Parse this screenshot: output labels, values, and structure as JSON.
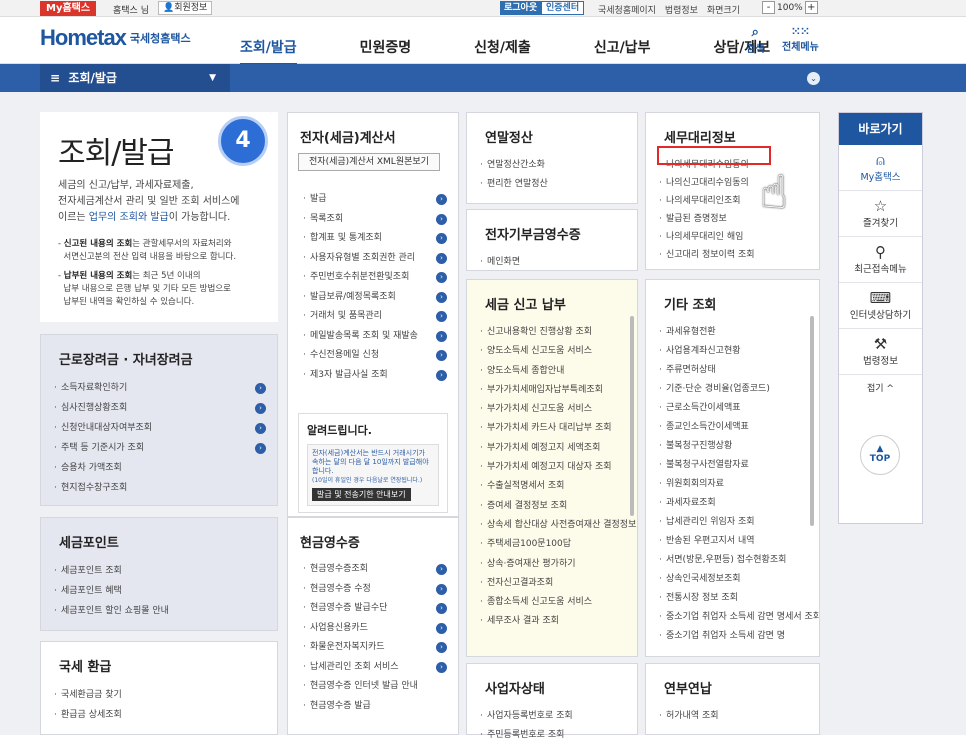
{
  "topbar": {
    "mytax": "My홈택스",
    "user": "홈택스 님",
    "member_info": "회원정보",
    "logout": "로그아웃",
    "cert_center": "인증센터",
    "links": [
      "국세청홈페이지",
      "법령정보",
      "화면크기"
    ],
    "zoom_minus": "-",
    "zoom": "100%",
    "zoom_plus": "+"
  },
  "header": {
    "logo": "Hometax",
    "logo_sub": "국세청홈택스",
    "nav": [
      "조회/발급",
      "민원증명",
      "신청/제출",
      "신고/납부",
      "상담/제보"
    ],
    "search": "검색",
    "all_menu": "전체메뉴"
  },
  "bluebar": {
    "section": "조회/발급"
  },
  "intro": {
    "title": "조회/발급",
    "step": "4",
    "desc1": "세금의 신고/납부, 과세자료제출,",
    "desc2": "전자세금계산서 관리 및 일반 조회 서비스에",
    "desc3a": "이르는 ",
    "desc3b": "업무의 조회와 발급",
    "desc3c": "이 가능합니다.",
    "note1a": "신고된 내용의 조회",
    "note1b": "는 관할세무서의 자료처리와",
    "note1c": "서면신고분의 전산 입력 내용을 바탕으로 합니다.",
    "note2a": "납부된 내용의 조회",
    "note2b": "는 최근 5년 이내의",
    "note2c": "납부 내용으로 은행 납부 및 기타 모든 방법으로",
    "note2d": "납부된 내역을 확인하실 수 있습니다."
  },
  "earned": {
    "title": "근로장려금 · 자녀장려금",
    "items": [
      "소득자료확인하기",
      "심사진행상황조회",
      "신청안내대상자여부조회",
      "주택 등 기준시가 조회",
      "승용차 가액조회",
      "현지접수창구조회"
    ]
  },
  "point": {
    "title": "세금포인트",
    "items": [
      "세금포인트 조회",
      "세금포인트 혜택",
      "세금포인트 할인 쇼핑몰 안내"
    ]
  },
  "refund": {
    "title": "국세 환급",
    "items": [
      "국세환급금 찾기",
      "환급금 상세조회"
    ]
  },
  "einvoice": {
    "title": "전자(세금)계산서",
    "xml_button": "전자(세금)계산서 XML원본보기",
    "items": [
      "발급",
      "목록조회",
      "합계표 및 통계조회",
      "사용자유형별 조회권한 관리",
      "주민번호수취분전환및조회",
      "발급보류/예정목록조회",
      "거래처 및 품목관리",
      "메일발송목록 조회 및 재발송",
      "수신전용메일 신청",
      "제3자 발급사실 조회"
    ]
  },
  "notice": {
    "title": "알려드립니다.",
    "body1": "전자(세금)계산서는 반드시 거래시기가",
    "body2": "속하는 달의 다음 달 10일까지 발급해야",
    "body3": "합니다.",
    "body4": "(10일이 휴일인 경우 다음날로 연장됩니다.)",
    "button": "발급 및 전송기한 안내보기"
  },
  "cashreceipt": {
    "title": "현금영수증",
    "items": [
      "현금영수증조회",
      "현금영수증 수정",
      "현금영수증 발급수단",
      "사업용신용카드",
      "화물운전자복지카드",
      "납세관리인 조회 서비스",
      "현금영수증 인터넷 발급 안내",
      "현금영수증 발급"
    ]
  },
  "yearend": {
    "title": "연말정산",
    "items": [
      "연말정산간소화",
      "편리한 연말정산"
    ]
  },
  "donation": {
    "title": "전자기부금영수증",
    "items": [
      "메인화면"
    ]
  },
  "taxfiling": {
    "title": "세금 신고 납부",
    "items": [
      "신고내용확인 진행상황 조회",
      "양도소득세 신고도움 서비스",
      "양도소득세 종합안내",
      "부가가치세매입자납부특례조회",
      "부가가치세 신고도움 서비스",
      "부가가치세 카드사 대리납부 조회",
      "부가가치세 예정고지 세액조회",
      "부가가치세 예정고지 대상자 조회",
      "수출실적명세서 조회",
      "증여세 결정정보 조회",
      "상속세 합산대상 사전증여재산 결정정보 조회",
      "주택세금100문100답",
      "상속·증여재산 평가하기",
      "전자신고결과조회",
      "종합소득세 신고도움 서비스",
      "세무조사 결과 조회"
    ]
  },
  "biz": {
    "title": "사업자상태",
    "items": [
      "사업자등록번호로 조회",
      "주민등록번호로 조회"
    ]
  },
  "agent": {
    "title": "세무대리정보",
    "items": [
      "나의세무대리수임동의",
      "나의신고대리수임동의",
      "나의세무대리인조회",
      "발급된 증명정보",
      "나의세무대리인 해임",
      "신고대리 정보이력 조회"
    ]
  },
  "other": {
    "title": "기타 조회",
    "items": [
      "과세유형전환",
      "사업용계좌신고현황",
      "주류면허상태",
      "기준·단순 경비율(업종코드)",
      "근로소득간이세액표",
      "종교인소득간이세액표",
      "불복청구진행상황",
      "불복청구사전열람자료",
      "위원회회의자료",
      "과세자료조회",
      "납세관리인 위임자 조회",
      "반송된 우편고지서 내역",
      "서면(방문,우편등) 접수현황조회",
      "상속인국세정보조회",
      "전통시장 정보 조회",
      "중소기업 취업자 소득세 감면 명세서 조회",
      "중소기업 취업자 소득세 감면 명"
    ]
  },
  "pension": {
    "title": "연부연납",
    "items": [
      "허가내역 조회"
    ]
  },
  "quick": {
    "title": "바로가기",
    "items": [
      {
        "label": "My홈택스",
        "icon": "person-icon"
      },
      {
        "label": "즐겨찾기",
        "icon": "star-icon"
      },
      {
        "label": "최근접속메뉴",
        "icon": "recent-icon"
      },
      {
        "label": "인터넷상담하기",
        "icon": "laptop-icon"
      },
      {
        "label": "법령정보",
        "icon": "gavel-icon"
      }
    ],
    "fold": "접기 ^",
    "top": "TOP"
  }
}
